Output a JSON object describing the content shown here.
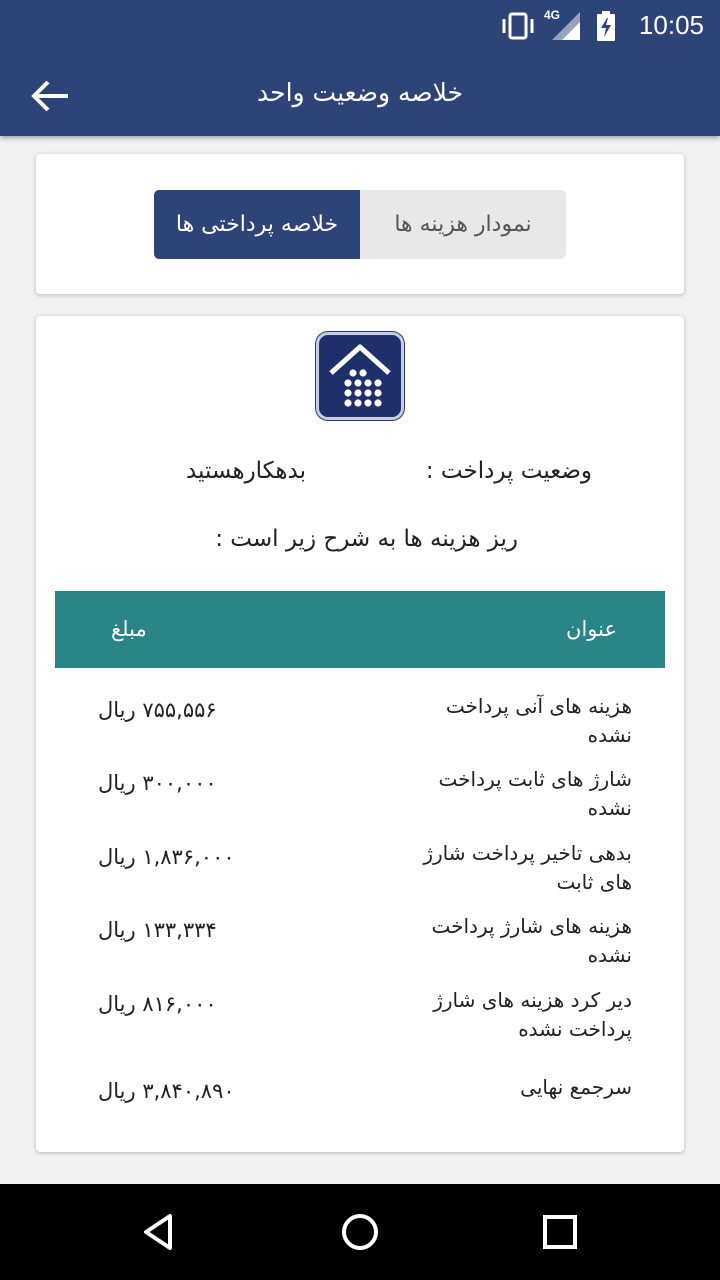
{
  "status_bar": {
    "time": "10:05",
    "network_label": "4G",
    "icons": [
      "vibrate-icon",
      "signal-icon",
      "battery-charging-icon"
    ]
  },
  "app_bar": {
    "title": "خلاصه وضعیت واحد",
    "back_icon": "arrow-back-icon"
  },
  "tabs": [
    {
      "label": "خلاصه پرداختی ها",
      "active": true
    },
    {
      "label": "نمودار هزینه ها",
      "active": false
    }
  ],
  "summary": {
    "logo_icon": "building-keypad-icon",
    "payment_status_label": "وضعیت پرداخت :",
    "payment_status_value": "بدهکارهستید",
    "subtitle": "ریز هزینه ها به شرح زیر است :"
  },
  "table": {
    "headers": {
      "title": "عنوان",
      "amount": "مبلغ"
    },
    "rows": [
      {
        "title": "هزینه های آنی پرداخت نشده",
        "amount": "۷۵۵,۵۵۶ ریال"
      },
      {
        "title": "شارژ های ثابت پرداخت نشده",
        "amount": "۳۰۰,۰۰۰ ریال"
      },
      {
        "title": "بدهی تاخیر پرداخت شارژ های ثابت",
        "amount": "۱,۸۳۶,۰۰۰ ریال"
      },
      {
        "title": "هزینه های شارژ پرداخت نشده",
        "amount": "۱۳۳,۳۳۴ ریال"
      },
      {
        "title": "دیر کرد هزینه های شارژ پرداخت نشده",
        "amount": "۸۱۶,۰۰۰ ریال"
      },
      {
        "title": "سرجمع نهایی",
        "amount": "۳,۸۴۰,۸۹۰ ریال"
      }
    ]
  },
  "nav_bar": {
    "icons": [
      "back-triangle-icon",
      "home-circle-icon",
      "recents-square-icon"
    ]
  },
  "colors": {
    "primary": "#2d4478",
    "table_header": "#2a8586",
    "tab_inactive": "#e8e8e8"
  }
}
